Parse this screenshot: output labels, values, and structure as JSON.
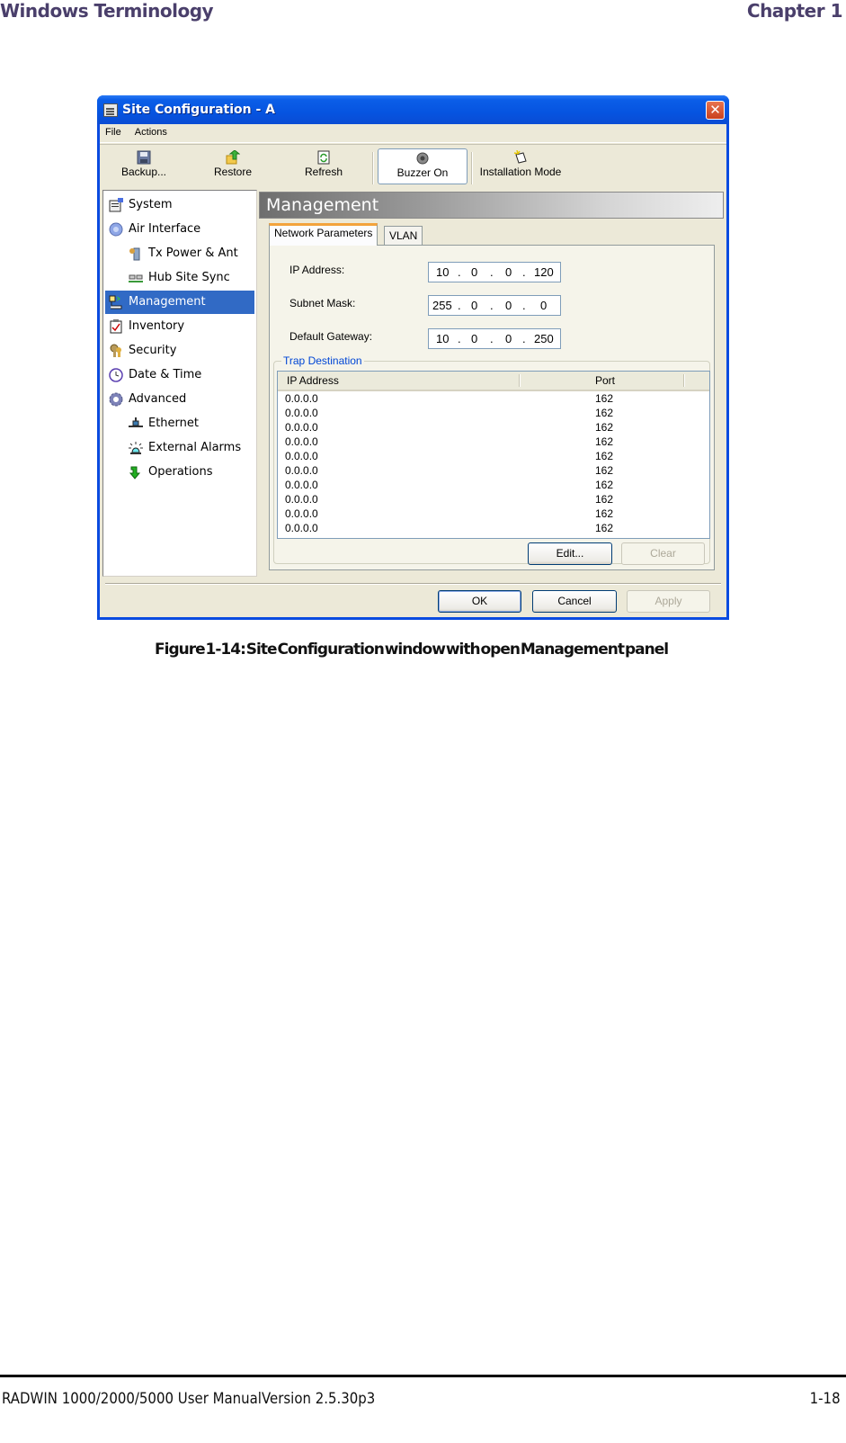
{
  "page_header": {
    "section": "Windows Terminology",
    "chapter": "Chapter 1"
  },
  "window": {
    "title": "Site Configuration - A",
    "close_label": "✕",
    "menu": [
      "File",
      "Actions"
    ],
    "toolbar": [
      {
        "label": "Backup...",
        "icon": "floppy-disk-icon"
      },
      {
        "label": "Restore",
        "icon": "restore-folder-icon"
      },
      {
        "label": "Refresh",
        "icon": "refresh-document-icon"
      },
      {
        "label": "Buzzer On",
        "icon": "buzzer-icon",
        "pressed": true
      },
      {
        "label": "Installation Mode",
        "icon": "installation-mode-icon"
      }
    ],
    "nav": [
      {
        "label": "System",
        "icon": "system-icon",
        "level": 0
      },
      {
        "label": "Air Interface",
        "icon": "air-interface-icon",
        "level": 0
      },
      {
        "label": "Tx Power & Ant",
        "icon": "antenna-icon",
        "level": 1
      },
      {
        "label": "Hub Site Sync",
        "icon": "hub-sync-icon",
        "level": 1
      },
      {
        "label": "Management",
        "icon": "management-icon",
        "level": 0,
        "selected": true
      },
      {
        "label": "Inventory",
        "icon": "inventory-icon",
        "level": 0
      },
      {
        "label": "Security",
        "icon": "security-keys-icon",
        "level": 0
      },
      {
        "label": "Date & Time",
        "icon": "clock-icon",
        "level": 0
      },
      {
        "label": "Advanced",
        "icon": "gear-icon",
        "level": 0
      },
      {
        "label": "Ethernet",
        "icon": "ethernet-icon",
        "level": 1
      },
      {
        "label": "External Alarms",
        "icon": "alarm-icon",
        "level": 1
      },
      {
        "label": "Operations",
        "icon": "operations-arrow-icon",
        "level": 1
      }
    ],
    "panel": {
      "title": "Management",
      "tabs": [
        "Network Parameters",
        "VLAN"
      ],
      "active_tab": "Network Parameters",
      "fields": [
        {
          "label": "IP Address:",
          "octets": [
            "10",
            "0",
            "0",
            "120"
          ]
        },
        {
          "label": "Subnet Mask:",
          "octets": [
            "255",
            "0",
            "0",
            "0"
          ]
        },
        {
          "label": "Default Gateway:",
          "octets": [
            "10",
            "0",
            "0",
            "250"
          ]
        }
      ],
      "trap_destination": {
        "title": "Trap Destination",
        "columns": [
          "IP Address",
          "Port"
        ],
        "rows": [
          [
            "0.0.0.0",
            "162"
          ],
          [
            "0.0.0.0",
            "162"
          ],
          [
            "0.0.0.0",
            "162"
          ],
          [
            "0.0.0.0",
            "162"
          ],
          [
            "0.0.0.0",
            "162"
          ],
          [
            "0.0.0.0",
            "162"
          ],
          [
            "0.0.0.0",
            "162"
          ],
          [
            "0.0.0.0",
            "162"
          ],
          [
            "0.0.0.0",
            "162"
          ],
          [
            "0.0.0.0",
            "162"
          ]
        ],
        "edit_label": "Edit...",
        "clear_label": "Clear"
      }
    },
    "buttons": {
      "ok": "OK",
      "cancel": "Cancel",
      "apply": "Apply"
    }
  },
  "caption": "Figure 1-14: Site Configuration window with open Management panel",
  "footer": {
    "left": "RADWIN 1000/2000/5000 User ManualVersion  2.5.30p3",
    "right": "1-18"
  }
}
